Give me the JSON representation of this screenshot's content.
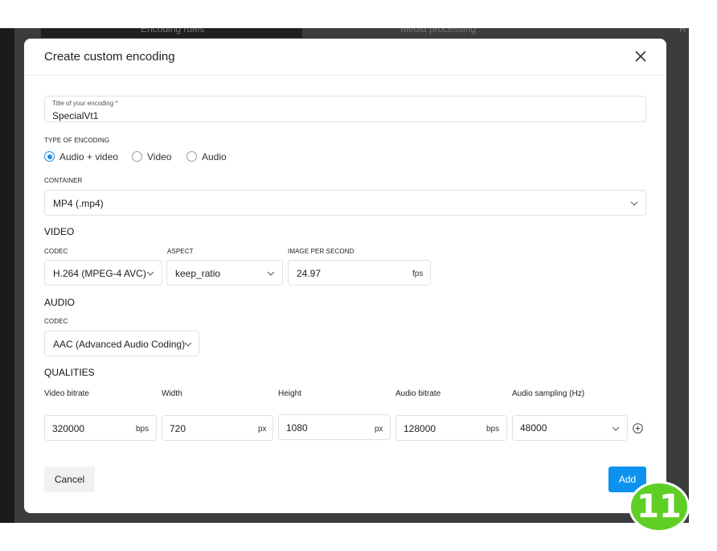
{
  "background": {
    "tab_left": "Encoding rules",
    "tab_right": "Media processing",
    "edge_text": "R"
  },
  "modal": {
    "title": "Create custom encoding",
    "close_icon": "close-icon"
  },
  "title_field": {
    "label": "Title of your encoding *",
    "value": "SpecialVt1"
  },
  "encoding_type": {
    "label": "TYPE OF ENCODING",
    "options": [
      "Audio + video",
      "Video",
      "Audio"
    ],
    "selected": "Audio + video"
  },
  "container": {
    "label": "CONTAINER",
    "value": "MP4 (.mp4)"
  },
  "video": {
    "title": "VIDEO",
    "codec_label": "CODEC",
    "codec_value": "H.264 (MPEG-4 AVC)",
    "aspect_label": "ASPECT",
    "aspect_value": "keep_ratio",
    "fps_label": "IMAGE PER SECOND",
    "fps_value": "24.97",
    "fps_unit": "fps"
  },
  "audio": {
    "title": "AUDIO",
    "codec_label": "CODEC",
    "codec_value": "AAC (Advanced Audio Coding)"
  },
  "qualities": {
    "title": "QUALITIES",
    "columns": [
      "Video bitrate",
      "Width",
      "Height",
      "Audio bitrate",
      "Audio sampling (Hz)"
    ],
    "row": {
      "video_bitrate": "320000",
      "video_bitrate_unit": "bps",
      "width": "720",
      "width_unit": "px",
      "height": "1080",
      "height_unit": "px",
      "audio_bitrate": "128000",
      "audio_bitrate_unit": "bps",
      "audio_sampling": "48000"
    }
  },
  "actions": {
    "cancel": "Cancel",
    "add": "Add"
  },
  "step_badge": "11",
  "colors": {
    "accent": "#0e92f0",
    "badge": "#5fcf26",
    "backdrop": "#3c3c3c"
  }
}
